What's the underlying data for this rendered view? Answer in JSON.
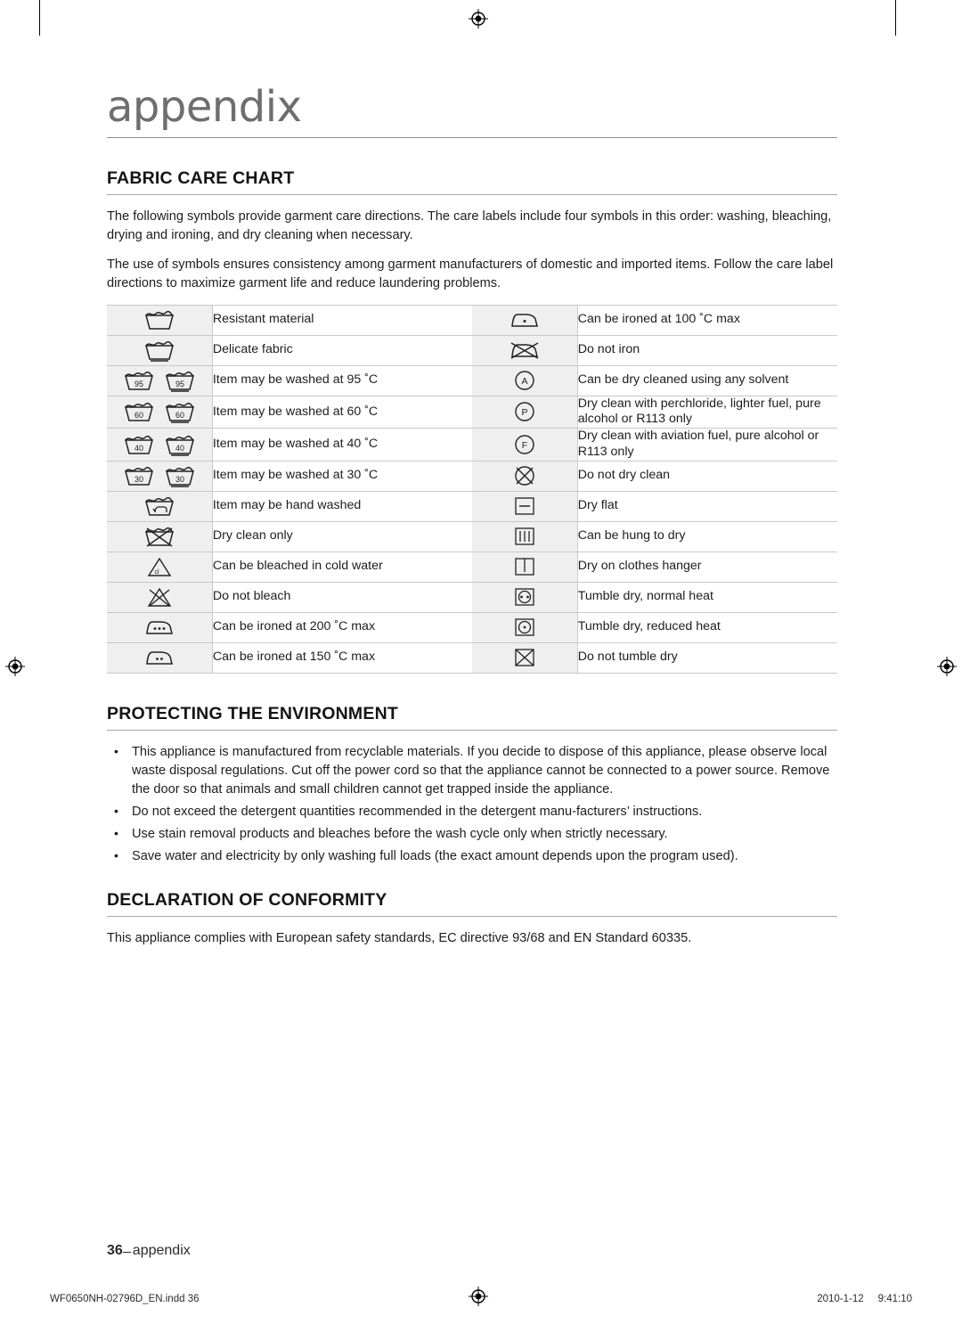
{
  "document": {
    "title": "appendix",
    "sections": [
      {
        "heading": "FABRIC CARE CHART",
        "paragraphs": [
          "The following symbols provide garment care directions. The care labels include four symbols in this order: washing, bleaching, drying and ironing, and dry cleaning when necessary.",
          "The use of symbols ensures consistency among garment manufacturers of domestic and imported items. Follow the care label directions to maximize garment life and reduce laundering problems."
        ]
      },
      {
        "heading": "PROTECTING THE ENVIRONMENT",
        "bullets": [
          "This appliance is manufactured from recyclable materials. If you decide to dispose of this appliance, please observe local waste disposal regulations. Cut off the power cord so that the appliance cannot be connected to a power source. Remove the door so that animals and small children cannot get trapped inside the appliance.",
          "Do not exceed the detergent quantities recommended in the detergent manu-facturers’ instructions.",
          "Use stain removal products and bleaches before the wash cycle only when strictly necessary.",
          "Save water and electricity by only washing full loads (the exact amount depends upon the program used)."
        ]
      },
      {
        "heading": "DECLARATION OF CONFORMITY",
        "paragraphs": [
          "This appliance complies with European safety standards, EC directive 93/68 and EN Standard 60335."
        ]
      }
    ]
  },
  "care_chart": {
    "rows": [
      {
        "left_symbol": "wash-tub-resistant",
        "left_text": "Resistant material",
        "right_symbol": "iron-one-dot",
        "right_text": "Can be ironed at 100 ˚C max"
      },
      {
        "left_symbol": "wash-tub-delicate",
        "left_text": "Delicate fabric",
        "right_symbol": "iron-crossed",
        "right_text": "Do not iron"
      },
      {
        "left_symbol": "wash-95",
        "left_text": "Item may be washed at 95 ˚C",
        "right_symbol": "dryclean-A",
        "right_text": "Can be dry cleaned using any solvent"
      },
      {
        "left_symbol": "wash-60",
        "left_text": "Item may be washed at 60 ˚C",
        "right_symbol": "dryclean-P",
        "right_text": "Dry clean with perchloride, lighter fuel, pure alcohol or R113 only"
      },
      {
        "left_symbol": "wash-40",
        "left_text": "Item may be washed at 40 ˚C",
        "right_symbol": "dryclean-F",
        "right_text": "Dry clean with aviation fuel, pure alcohol or R113 only"
      },
      {
        "left_symbol": "wash-30",
        "left_text": "Item may be washed at 30 ˚C",
        "right_symbol": "dryclean-crossed",
        "right_text": "Do not dry clean"
      },
      {
        "left_symbol": "hand-wash",
        "left_text": "Item may be hand washed",
        "right_symbol": "dry-flat",
        "right_text": "Dry flat"
      },
      {
        "left_symbol": "dryclean-only",
        "left_text": "Dry clean only",
        "right_symbol": "hang-to-dry",
        "right_text": "Can be hung to dry"
      },
      {
        "left_symbol": "bleach-cold",
        "left_text": "Can be bleached in cold water",
        "right_symbol": "drip-dry-hanger",
        "right_text": "Dry on clothes hanger"
      },
      {
        "left_symbol": "no-bleach",
        "left_text": "Do not bleach",
        "right_symbol": "tumble-normal",
        "right_text": "Tumble dry, normal heat"
      },
      {
        "left_symbol": "iron-three-dot",
        "left_text": "Can be ironed at 200 ˚C max",
        "right_symbol": "tumble-reduced",
        "right_text": "Tumble dry, reduced heat"
      },
      {
        "left_symbol": "iron-two-dot",
        "left_text": "Can be ironed at 150 ˚C max",
        "right_symbol": "tumble-crossed",
        "right_text": "Do not tumble dry"
      }
    ],
    "temp_labels": {
      "t95": "95",
      "t60": "60",
      "t40": "40",
      "t30": "30"
    },
    "dryclean_letters": {
      "any": "A",
      "perchloride": "P",
      "aviation": "F"
    }
  },
  "footer": {
    "page_number": "36",
    "page_label": "appendix",
    "print_file": "WF0650NH-02796D_EN.indd   36",
    "print_date": "2010-1-12",
    "print_time": "9:41:10"
  }
}
